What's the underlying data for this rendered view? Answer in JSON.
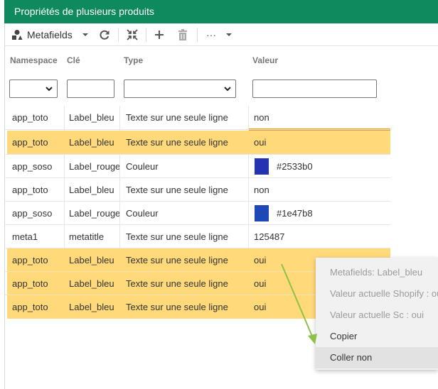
{
  "title": "Propriétés de plusieurs produits",
  "toolbar": {
    "metafields_label": "Metafields",
    "more_label": "···"
  },
  "columns": {
    "namespace": "Namespace",
    "key": "Clé",
    "type": "Type",
    "value": "Valeur"
  },
  "filters": {
    "namespace": "",
    "key": "",
    "type": "",
    "value": ""
  },
  "rows": [
    {
      "namespace": "app_toto",
      "key": "Label_bleu",
      "type": "Texte sur une seule ligne",
      "value": "non"
    },
    {
      "namespace": "app_toto",
      "key": "Label_bleu",
      "type": "Texte sur une seule ligne",
      "value": "oui"
    },
    {
      "namespace": "app_soso",
      "key": "Label_rouge",
      "type": "Couleur",
      "value": "#2533b0"
    },
    {
      "namespace": "app_toto",
      "key": "Label_bleu",
      "type": "Texte sur une seule ligne",
      "value": "non"
    },
    {
      "namespace": "app_soso",
      "key": "Label_rouge",
      "type": "Couleur",
      "value": "#1e47b8"
    },
    {
      "namespace": "meta1",
      "key": "metatitle",
      "type": "Texte sur une seule ligne",
      "value": "125487"
    },
    {
      "namespace": "app_toto",
      "key": "Label_bleu",
      "type": "Texte sur une seule ligne",
      "value": "oui"
    },
    {
      "namespace": "app_toto",
      "key": "Label_bleu",
      "type": "Texte sur une seule ligne",
      "value": "oui"
    },
    {
      "namespace": "app_toto",
      "key": "Label_bleu",
      "type": "Texte sur une seule ligne",
      "value": "oui"
    }
  ],
  "context_menu": {
    "items": [
      "Metafields: Label_bleu",
      "Valeur actuelle Shopify : oui",
      "Valeur actuelle Sc : oui",
      "Copier",
      "Coller non"
    ]
  },
  "colors": {
    "header": "#0f8a5f",
    "highlight": "#ffd97a",
    "accent": "#f29a16",
    "arrow": "#8fc14a"
  }
}
